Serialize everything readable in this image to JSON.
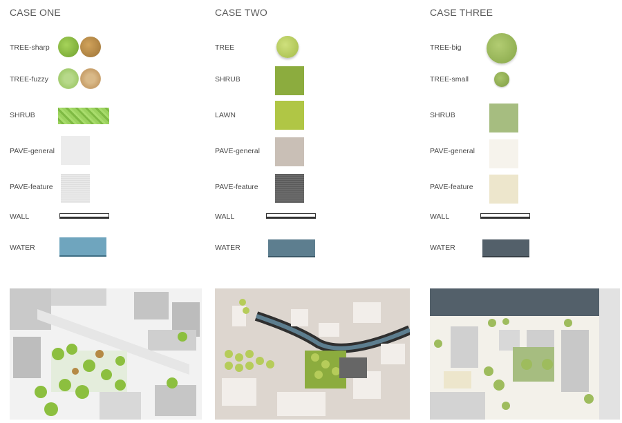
{
  "cases": [
    {
      "title": "CASE ONE",
      "items": [
        {
          "label": "TREE-sharp"
        },
        {
          "label": "TREE-fuzzy"
        },
        {
          "label": "SHRUB"
        },
        {
          "label": "PAVE-general"
        },
        {
          "label": "PAVE-feature"
        },
        {
          "label": "WALL"
        },
        {
          "label": "WATER"
        }
      ],
      "colors": {
        "tree_green": "#8cbf3f",
        "tree_brown": "#b58a45",
        "shrub": "#8ccb4f",
        "pave_general": "#ececec",
        "pave_feature": "#e6e6e6",
        "water": "#6fa5be"
      }
    },
    {
      "title": "CASE TWO",
      "items": [
        {
          "label": "TREE"
        },
        {
          "label": "SHRUB"
        },
        {
          "label": "LAWN"
        },
        {
          "label": "PAVE-general"
        },
        {
          "label": "PAVE-feature"
        },
        {
          "label": "WALL"
        },
        {
          "label": "WATER"
        }
      ],
      "colors": {
        "tree": "#b6cc5a",
        "shrub": "#8cac3e",
        "lawn": "#b0c645",
        "pave_general": "#c9bfb6",
        "pave_feature": "#666666",
        "water": "#5d7e8f"
      }
    },
    {
      "title": "CASE THREE",
      "items": [
        {
          "label": "TREE-big"
        },
        {
          "label": "TREE-small"
        },
        {
          "label": "SHRUB"
        },
        {
          "label": "PAVE-general"
        },
        {
          "label": "PAVE-feature"
        },
        {
          "label": "WALL"
        },
        {
          "label": "WATER"
        }
      ],
      "colors": {
        "tree": "#9ebc5d",
        "shrub": "#a6bd80",
        "pave_general": "#f6f3ec",
        "pave_feature": "#ede6cc",
        "water": "#53606a"
      }
    }
  ]
}
